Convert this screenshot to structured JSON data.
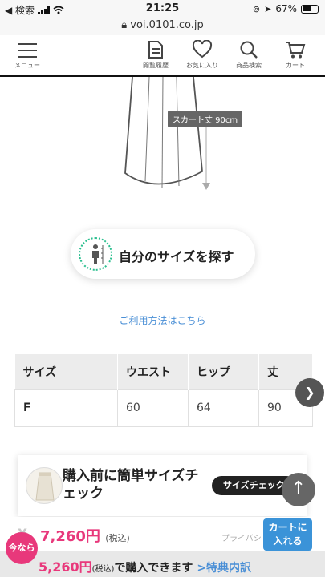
{
  "status_bar": {
    "back_label": "◀ 検索",
    "time": "21:25",
    "battery": "67%"
  },
  "browser": {
    "url": "voi.0101.co.jp"
  },
  "header": {
    "menu_label": "メニュー",
    "nav": [
      {
        "label": "閲覧履歴",
        "icon": "document-icon"
      },
      {
        "label": "お気に入り",
        "icon": "heart-icon"
      },
      {
        "label": "商品検索",
        "icon": "search-icon"
      },
      {
        "label": "カート",
        "icon": "cart-icon"
      }
    ]
  },
  "illustration": {
    "skirt_length_tag": "スカート丈 90cm"
  },
  "size_finder": {
    "label": "自分のサイズを探す"
  },
  "howto_link": "ご利用方法はこちら",
  "size_table": {
    "headers": [
      "サイズ",
      "ウエスト",
      "ヒップ",
      "丈"
    ],
    "rows": [
      [
        "F",
        "60",
        "64",
        "90"
      ]
    ]
  },
  "size_check_card": {
    "title": "購入前に簡単サイズチェック",
    "button": "サイズチェック"
  },
  "purchase_bar": {
    "old_price": "¥",
    "price": "7,260円",
    "tax_label": "(税込)",
    "privacy": "プライバシ",
    "cart_button_line1": "カートに",
    "cart_button_line2": "入れる"
  },
  "promo": {
    "badge": "今なら",
    "price": "5,260円",
    "tax_label": "(税込)",
    "text": "で購入できます",
    "link": ">特典内訳"
  },
  "colors": {
    "accent_pink": "#e8387b",
    "link_blue": "#4a8fd6",
    "cart_blue": "#3b93d8"
  }
}
